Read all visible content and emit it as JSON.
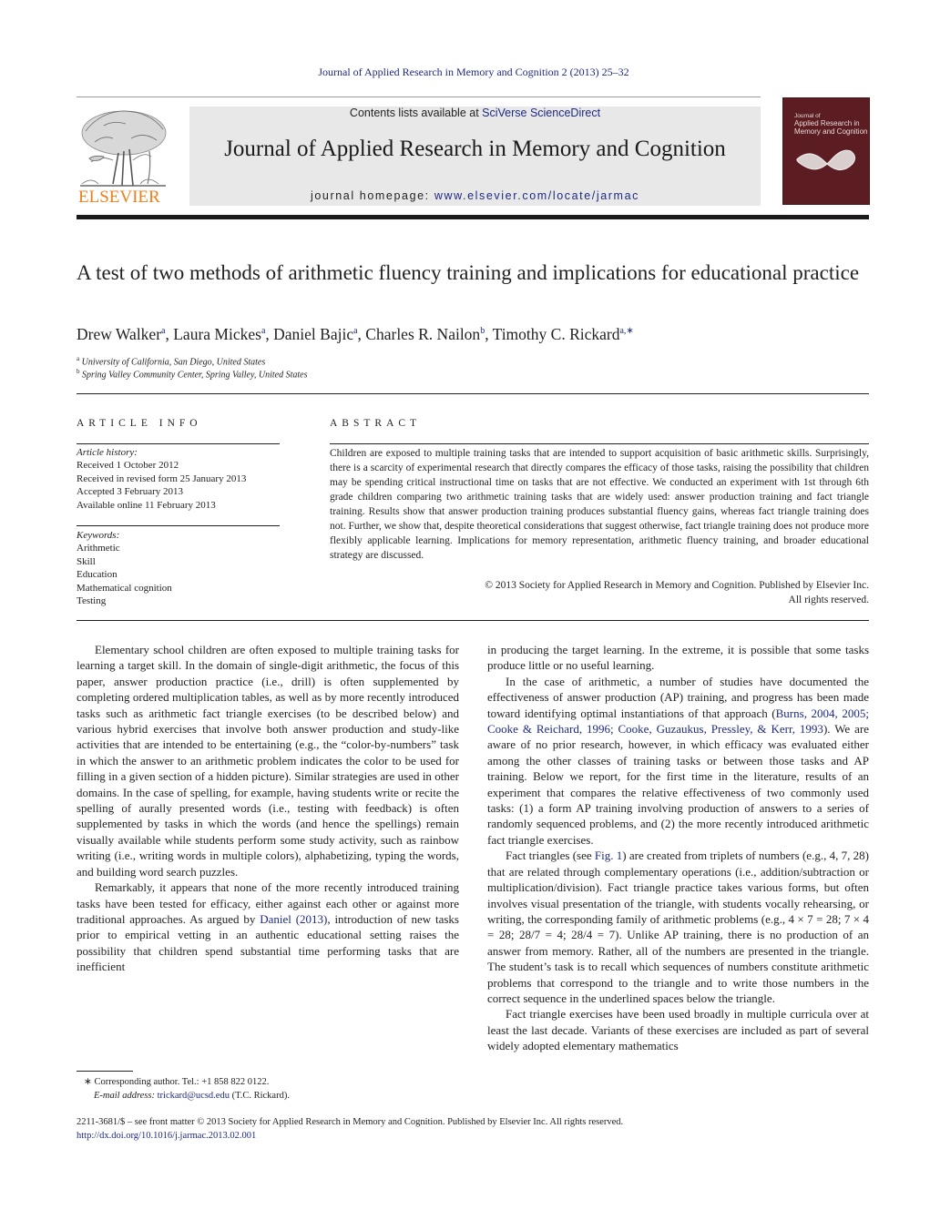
{
  "header": {
    "running_head": "Journal of Applied Research in Memory and Cognition 2 (2013) 25–32",
    "contents_prefix": "Contents lists available at ",
    "contents_link": "SciVerse ScienceDirect",
    "journal_title": "Journal of Applied Research in Memory and Cognition",
    "homepage_prefix": "journal homepage: ",
    "homepage_link": "www.elsevier.com/locate/jarmac",
    "publisher_logo_text": "ELSEVIER",
    "cover": {
      "line1": "Journal of",
      "line2": "Applied Research in",
      "line3": "Memory and Cognition"
    }
  },
  "article": {
    "title": "A test of two methods of arithmetic fluency training and implications for educational practice",
    "authors": [
      {
        "name": "Drew Walker",
        "sup": "a"
      },
      {
        "name": "Laura Mickes",
        "sup": "a"
      },
      {
        "name": "Daniel Bajic",
        "sup": "a"
      },
      {
        "name": "Charles R. Nailon",
        "sup": "b"
      },
      {
        "name": "Timothy C. Rickard",
        "sup": "a,∗"
      }
    ],
    "affiliations": [
      {
        "sup": "a",
        "text": "University of California, San Diego, United States"
      },
      {
        "sup": "b",
        "text": "Spring Valley Community Center, Spring Valley, United States"
      }
    ]
  },
  "article_info": {
    "heading": "ARTICLE INFO",
    "history_label": "Article history:",
    "history": [
      "Received 1 October 2012",
      "Received in revised form 25 January 2013",
      "Accepted 3 February 2013",
      "Available online 11 February 2013"
    ],
    "keywords_label": "Keywords:",
    "keywords": [
      "Arithmetic",
      "Skill",
      "Education",
      "Mathematical cognition",
      "Testing"
    ]
  },
  "abstract": {
    "heading": "ABSTRACT",
    "body": "Children are exposed to multiple training tasks that are intended to support acquisition of basic arithmetic skills. Surprisingly, there is a scarcity of experimental research that directly compares the efficacy of those tasks, raising the possibility that children may be spending critical instructional time on tasks that are not effective. We conducted an experiment with 1st through 6th grade children comparing two arithmetic training tasks that are widely used: answer production training and fact triangle training. Results show that answer production training produces substantial fluency gains, whereas fact triangle training does not. Further, we show that, despite theoretical considerations that suggest otherwise, fact triangle training does not produce more flexibly applicable learning. Implications for memory representation, arithmetic fluency training, and broader educational strategy are discussed.",
    "copyright_line1": "© 2013 Society for Applied Research in Memory and Cognition. Published by Elsevier Inc.",
    "copyright_line2": "All rights reserved."
  },
  "body": {
    "left": {
      "p1": "Elementary school children are often exposed to multiple training tasks for learning a target skill. In the domain of single-digit arithmetic, the focus of this paper, answer production practice (i.e., drill) is often supplemented by completing ordered multiplication tables, as well as by more recently introduced tasks such as arithmetic fact triangle exercises (to be described below) and various hybrid exercises that involve both answer production and study-like activities that are intended to be entertaining (e.g., the “color-by-numbers” task in which the answer to an arithmetic problem indicates the color to be used for filling in a given section of a hidden picture). Similar strategies are used in other domains. In the case of spelling, for example, having students write or recite the spelling of aurally presented words (i.e., testing with feedback) is often supplemented by tasks in which the words (and hence the spellings) remain visually available while students perform some study activity, such as rainbow writing (i.e., writing words in multiple colors), alphabetizing, typing the words, and building word search puzzles.",
      "p2_before": "Remarkably, it appears that none of the more recently introduced training tasks have been tested for efficacy, either against each other or against more traditional approaches. As argued by ",
      "p2_link": "Daniel (2013)",
      "p2_after": ", introduction of new tasks prior to empirical vetting in an authentic educational setting raises the possibility that children spend substantial time performing tasks that are inefficient"
    },
    "right": {
      "p0": "in producing the target learning. In the extreme, it is possible that some tasks produce little or no useful learning.",
      "p1_before": "In the case of arithmetic, a number of studies have documented the effectiveness of answer production (AP) training, and progress has been made toward identifying optimal instantiations of that approach (",
      "p1_link": "Burns, 2004, 2005; Cooke & Reichard, 1996; Cooke, Guzaukus, Pressley, & Kerr, 1993",
      "p1_after": "). We are aware of no prior research, however, in which efficacy was evaluated either among the other classes of training tasks or between those tasks and AP training. Below we report, for the first time in the literature, results of an experiment that compares the relative effectiveness of two commonly used tasks: (1) a form AP training involving production of answers to a series of randomly sequenced problems, and (2) the more recently introduced arithmetic fact triangle exercises.",
      "p2_before": "Fact triangles (see ",
      "p2_link": "Fig. 1",
      "p2_after": ") are created from triplets of numbers (e.g., 4, 7, 28) that are related through complementary operations (i.e., addition/subtraction or multiplication/division). Fact triangle practice takes various forms, but often involves visual presentation of the triangle, with students vocally rehearsing, or writing, the corresponding family of arithmetic problems (e.g., 4 × 7 = 28; 7 × 4 = 28; 28/7 = 4; 28/4 = 7). Unlike AP training, there is no production of an answer from memory. Rather, all of the numbers are presented in the triangle. The student’s task is to recall which sequences of numbers constitute arithmetic problems that correspond to the triangle and to write those numbers in the correct sequence in the underlined spaces below the triangle.",
      "p3": "Fact triangle exercises have been used broadly in multiple curricula over at least the last decade. Variants of these exercises are included as part of several widely adopted elementary mathematics"
    }
  },
  "footnote": {
    "star": "∗",
    "line1": "Corresponding author. Tel.: +1 858 822 0122.",
    "email_label": "E-mail address:",
    "email": "trickard@ucsd.edu",
    "email_suffix": " (T.C. Rickard)."
  },
  "bottom": {
    "issn_line": "2211-3681/$ – see front matter © 2013 Society for Applied Research in Memory and Cognition. Published by Elsevier Inc. All rights reserved.",
    "doi": "http://dx.doi.org/10.1016/j.jarmac.2013.02.001"
  }
}
